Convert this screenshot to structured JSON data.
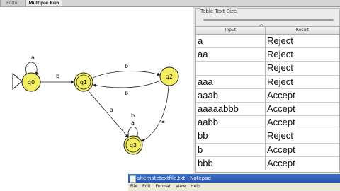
{
  "tabs": [
    {
      "label": "Editor"
    },
    {
      "label": "Multiple Run"
    }
  ],
  "automaton": {
    "states": [
      "q0",
      "q1",
      "q2",
      "q3"
    ],
    "initial": "q0",
    "final": [
      "q1",
      "q3"
    ],
    "transition_labels": [
      "a",
      "b",
      "b",
      "b",
      "a",
      "b",
      "a",
      "a"
    ],
    "state_color": "#f3ee62"
  },
  "table_text_size": {
    "label": "Table Text Size",
    "value": 0.4
  },
  "results_table": {
    "headers": [
      "Input",
      "Result"
    ],
    "rows": [
      {
        "input": "a",
        "result": "Reject"
      },
      {
        "input": "aa",
        "result": "Reject"
      },
      {
        "input": "",
        "result": "Reject"
      },
      {
        "input": "aaa",
        "result": "Reject"
      },
      {
        "input": "aaab",
        "result": "Accept"
      },
      {
        "input": "aaaaabbb",
        "result": "Accept"
      },
      {
        "input": "aabb",
        "result": "Accept"
      },
      {
        "input": "bb",
        "result": "Reject"
      },
      {
        "input": "b",
        "result": "Accept"
      },
      {
        "input": "bbb",
        "result": "Accept"
      }
    ]
  },
  "notepad": {
    "title": "alternatetextfile.txt - Notepad",
    "menu": [
      "File",
      "Edit",
      "Format",
      "View",
      "Help"
    ]
  }
}
